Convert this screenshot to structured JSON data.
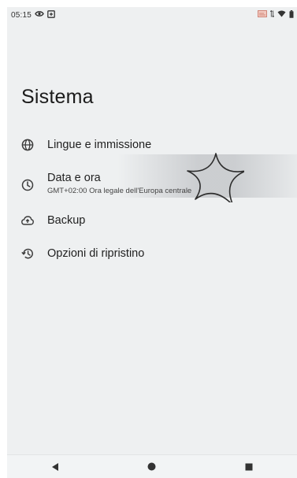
{
  "status_bar": {
    "time": "05:15",
    "left_icons": [
      "eye-icon",
      "screen-record-icon"
    ],
    "right_icons": [
      "cast-icon",
      "data-arrows-icon",
      "wifi-icon",
      "battery-icon"
    ]
  },
  "page": {
    "title": "Sistema"
  },
  "settings": [
    {
      "label": "Lingue e immissione",
      "summary": "",
      "icon": "globe-icon"
    },
    {
      "label": "Data e ora",
      "summary": "GMT+02:00 Ora legale dell'Europa centrale",
      "icon": "clock-icon"
    },
    {
      "label": "Backup",
      "summary": "",
      "icon": "cloud-upload-icon"
    },
    {
      "label": "Opzioni di ripristino",
      "summary": "",
      "icon": "history-icon"
    }
  ],
  "nav_bar": {
    "buttons": [
      "back-button",
      "home-button",
      "recents-button"
    ]
  },
  "colors": {
    "background": "#eef0f1",
    "text": "#1f1f1f",
    "icon": "#3c3c3c"
  }
}
